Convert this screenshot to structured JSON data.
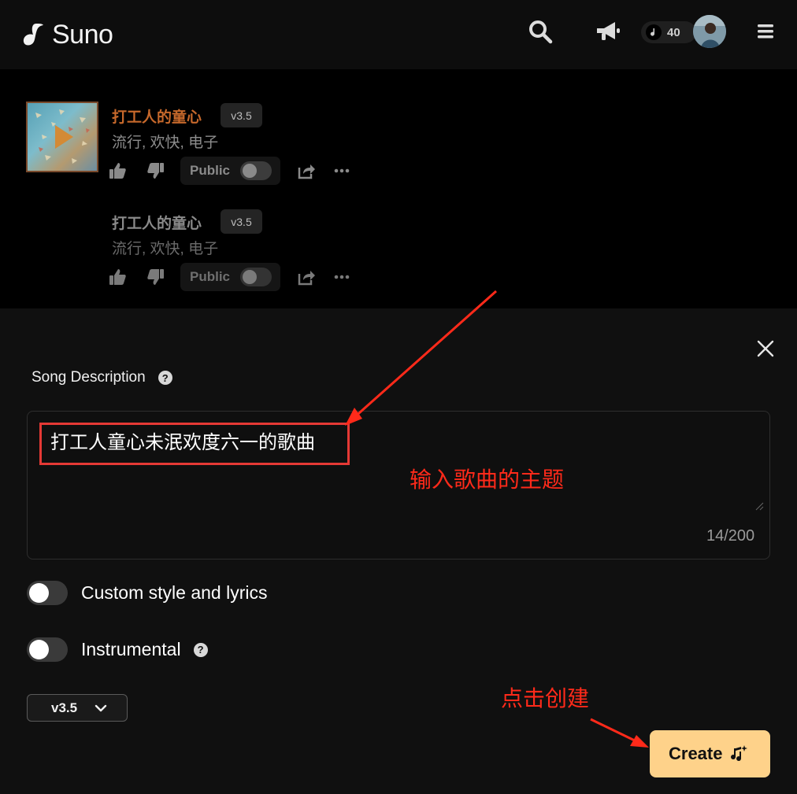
{
  "header": {
    "logo_text": "Suno",
    "credits": "40",
    "icons": [
      "suno-logo-icon",
      "search-icon",
      "megaphone-icon",
      "note-icon",
      "avatar",
      "menu-icon"
    ]
  },
  "songs": [
    {
      "title": "打工人的童心",
      "version": "v3.5",
      "tags": "流行, 欢快, 电子",
      "public_label": "Public"
    },
    {
      "title": "打工人的童心",
      "version": "v3.5",
      "tags": "流行, 欢快, 电子",
      "public_label": "Public"
    }
  ],
  "form": {
    "section_label": "Song Description",
    "help_glyph": "?",
    "description_value": "打工人童心未泯欢度六一的歌曲",
    "char_counter": "14/200",
    "custom_toggle_label": "Custom style and lyrics",
    "instrumental_toggle_label": "Instrumental",
    "version_select": "v3.5",
    "create_label": "Create"
  },
  "annotations": {
    "input_hint": "输入歌曲的主题",
    "click_hint": "点击创建"
  },
  "colors": {
    "accent_orange": "#c6682b",
    "create_button": "#fed28a",
    "annotation_red": "#ff2a1a"
  }
}
